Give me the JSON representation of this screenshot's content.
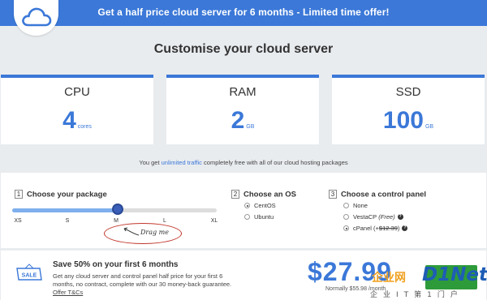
{
  "banner": {
    "text": "Get a half price cloud server for 6 months - Limited time offer!"
  },
  "title": "Customise your cloud server",
  "specs": [
    {
      "label": "CPU",
      "value": "4",
      "unit": "cores"
    },
    {
      "label": "RAM",
      "value": "2",
      "unit": "GB"
    },
    {
      "label": "SSD",
      "value": "100",
      "unit": "GB"
    }
  ],
  "traffic": {
    "before": "You get ",
    "link": "unlimited traffic",
    "after": " completely free with all of our cloud hosting packages"
  },
  "package": {
    "step": "1",
    "label": "Choose your package",
    "sizes": [
      "XS",
      "S",
      "M",
      "L",
      "XL"
    ],
    "selected": "M",
    "drag_hint": "Drag me"
  },
  "os": {
    "step": "2",
    "label": "Choose an OS",
    "options": [
      {
        "label": "CentOS",
        "checked": true
      },
      {
        "label": "Ubuntu",
        "checked": false
      }
    ]
  },
  "control_panel": {
    "step": "3",
    "label": "Choose a control panel",
    "options": [
      {
        "label": "None",
        "checked": false
      },
      {
        "label": "VestaCP",
        "note": "(Free)",
        "checked": false
      },
      {
        "label": "cPanel",
        "note_prefix": "(+",
        "note_price": "$12.39",
        "note_suffix": ")",
        "checked": true
      }
    ]
  },
  "sale": {
    "badge": "SALE",
    "title": "Save 50% on your first 6 months",
    "description": "Get any cloud server and control panel half price for your first 6 months, no contract, complete with our 30 money-back guarantee.",
    "offer_link": "Offer T&Cs",
    "price": "$27.99",
    "normally": "Normally $55.98 /month"
  },
  "watermark": {
    "cn": "企业网",
    "brand": "D1Net",
    "sub": "企业IT第1门户"
  },
  "colors": {
    "accent": "#3b78d8",
    "banner": "#3b78d8",
    "buy": "#2e9b3a",
    "drag_circle": "#c2362b"
  }
}
